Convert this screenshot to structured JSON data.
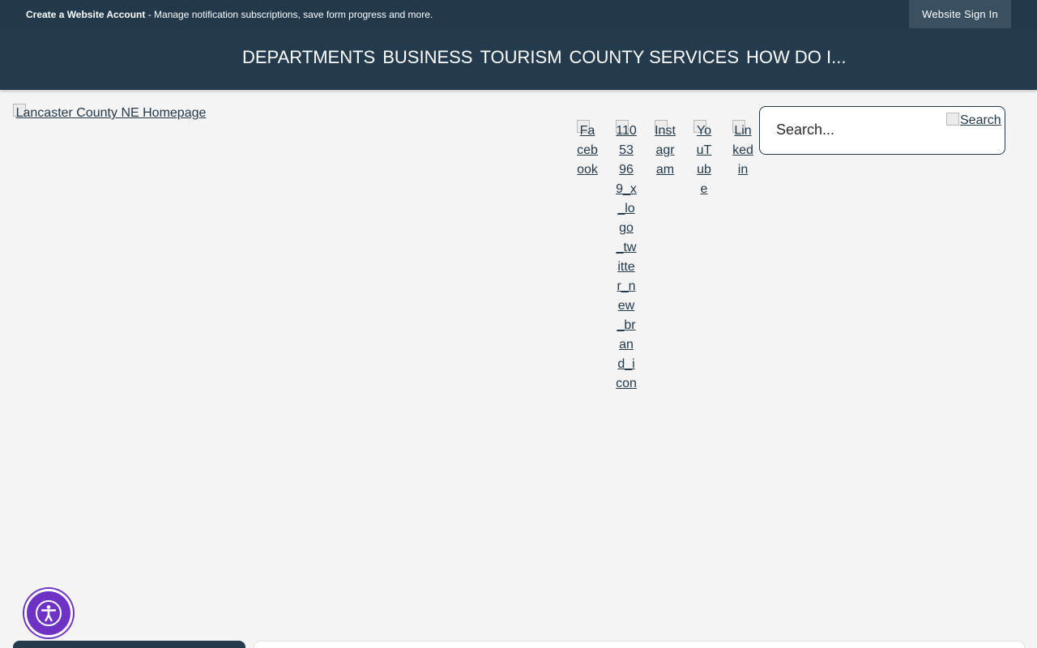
{
  "topbar": {
    "create_account": "Create a Website Account",
    "notice_rest": " - Manage notification subscriptions, save form progress and more.",
    "signin_label": "Website Sign In"
  },
  "nav": {
    "items": [
      {
        "label": "DEPARTMENTS"
      },
      {
        "label": "BUSINESS"
      },
      {
        "label": "TOURISM"
      },
      {
        "label": "COUNTY SERVICES"
      },
      {
        "label": "HOW DO I..."
      }
    ]
  },
  "logo": {
    "alt": "Lancaster County NE Homepage"
  },
  "social": {
    "facebook": "Facebook",
    "twitter": "1105396 9_x_logo_twitter_new_brand_icon",
    "instagram": "Instagram",
    "youtube": "YouTube",
    "linkedin": "Linkedin"
  },
  "search": {
    "placeholder": "Search...",
    "button_alt": "Search"
  },
  "colors": {
    "header_bg": "#22394c",
    "accessibility": "#6e33c4",
    "page_bg": "#f4f4f4"
  },
  "icons": {
    "accessibility": "accessibility-person-icon"
  }
}
